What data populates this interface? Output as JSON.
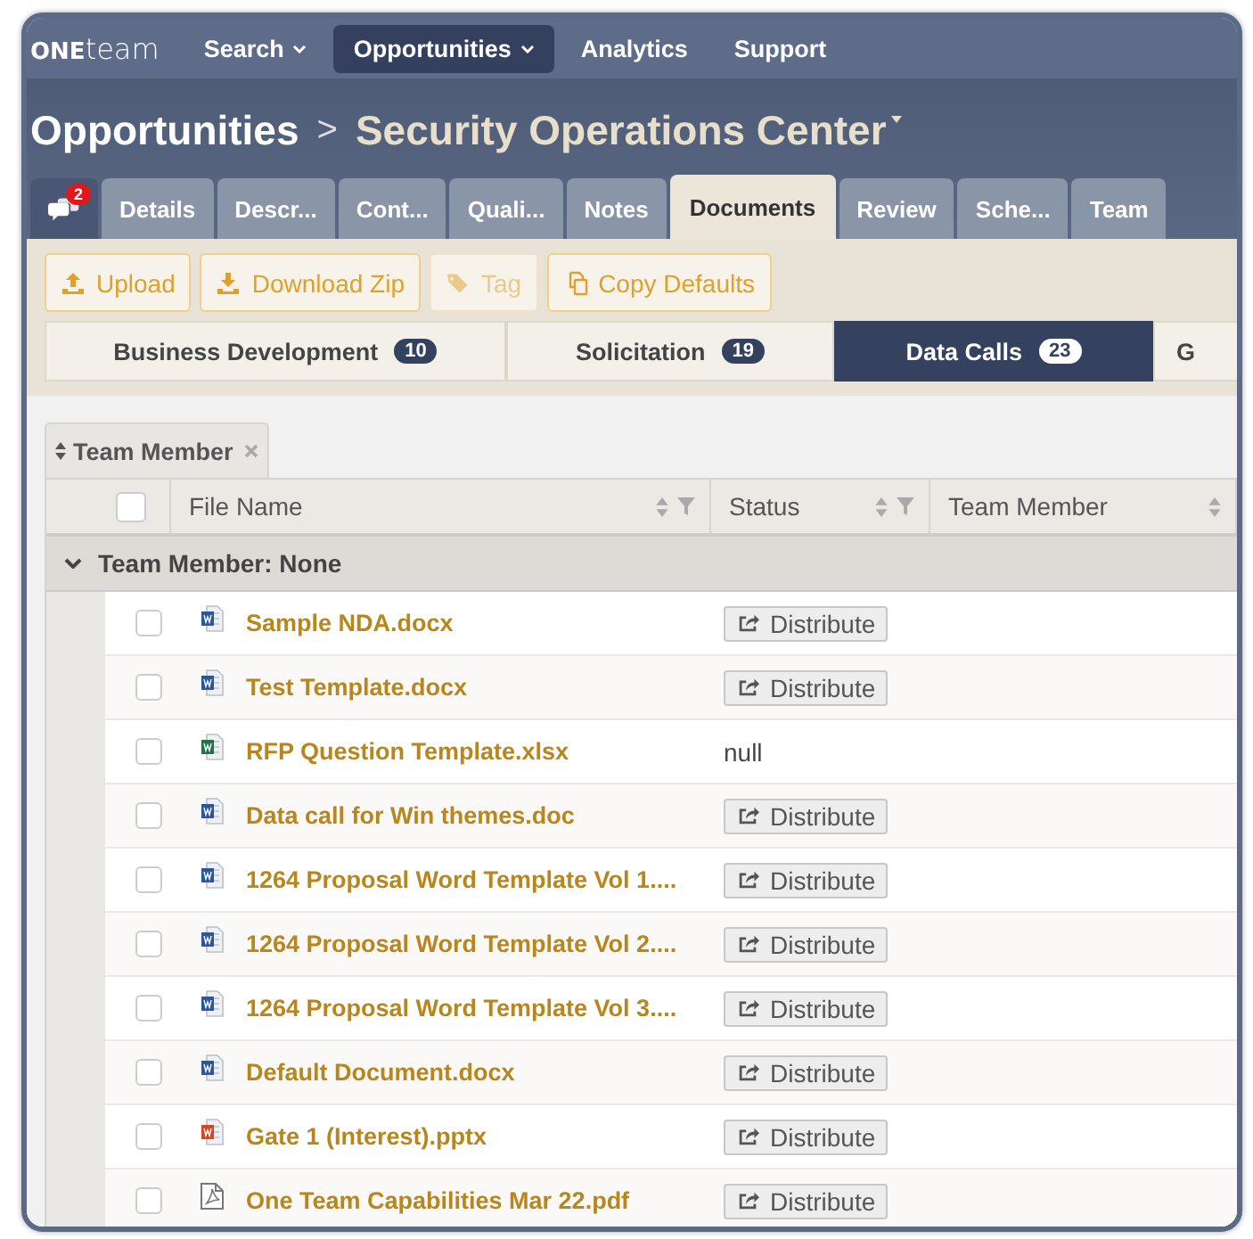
{
  "nav": {
    "brand": "**ONE**team",
    "items": [
      {
        "label": "Search",
        "dropdown": true,
        "selected": false
      },
      {
        "label": "Opportunities",
        "dropdown": true,
        "selected": true
      },
      {
        "label": "Analytics",
        "dropdown": false,
        "selected": false
      },
      {
        "label": "Support",
        "dropdown": false,
        "selected": false
      }
    ]
  },
  "breadcrumb": {
    "parent": "Opportunities",
    "separator": ">",
    "current": "Security Operations Center",
    "dropdown": true
  },
  "messages": {
    "count": "2"
  },
  "tabs": [
    {
      "label": "Details",
      "selected": false
    },
    {
      "label": "Descr...",
      "selected": false
    },
    {
      "label": "Cont...",
      "selected": false
    },
    {
      "label": "Quali...",
      "selected": false
    },
    {
      "label": "Notes",
      "selected": false
    },
    {
      "label": "Documents",
      "selected": true
    },
    {
      "label": "Review",
      "selected": false
    },
    {
      "label": "Sche...",
      "selected": false
    },
    {
      "label": "Team",
      "selected": false
    }
  ],
  "toolbar": [
    {
      "label": "Upload",
      "kind": "upload",
      "disabled": false
    },
    {
      "label": "Download Zip",
      "kind": "download",
      "disabled": false
    },
    {
      "label": "Tag",
      "kind": "tag",
      "disabled": true
    },
    {
      "label": "Copy Defaults",
      "kind": "copy",
      "disabled": false
    }
  ],
  "folders": [
    {
      "label": "Business Development",
      "count": "10",
      "selected": false
    },
    {
      "label": "Solicitation",
      "count": "19",
      "selected": false
    },
    {
      "label": "Data Calls",
      "count": "23",
      "selected": true
    },
    {
      "label": "G",
      "selected": false
    }
  ],
  "group_chip": {
    "label": "Team Member",
    "removable": true
  },
  "columns": [
    {
      "label": "File Name",
      "sortable": true,
      "filter": true
    },
    {
      "label": "Status",
      "sortable": true,
      "filter": true
    },
    {
      "label": "Team Member",
      "sortable": true,
      "filter": false
    }
  ],
  "header_checkbox": {
    "checked": false
  },
  "group": {
    "label": "Team Member: None",
    "expanded": true
  },
  "rows": [
    {
      "file": "Sample NDA.docx",
      "kind": "word",
      "checked": false,
      "status": {
        "kind": "button",
        "text": "Distribute"
      }
    },
    {
      "file": "Test Template.docx",
      "kind": "word",
      "checked": false,
      "status": {
        "kind": "button",
        "text": "Distribute"
      }
    },
    {
      "file": "RFP Question Template.xlsx",
      "kind": "excel",
      "checked": false,
      "status": {
        "kind": "text",
        "text": "null"
      }
    },
    {
      "file": "Data call for Win themes.doc",
      "kind": "word",
      "checked": false,
      "status": {
        "kind": "button",
        "text": "Distribute"
      }
    },
    {
      "file": "1264 Proposal Word Template Vol 1....",
      "kind": "word",
      "checked": false,
      "status": {
        "kind": "button",
        "text": "Distribute"
      }
    },
    {
      "file": "1264 Proposal Word Template Vol 2....",
      "kind": "word",
      "checked": false,
      "status": {
        "kind": "button",
        "text": "Distribute"
      }
    },
    {
      "file": "1264 Proposal Word Template Vol 3....",
      "kind": "word",
      "checked": false,
      "status": {
        "kind": "button",
        "text": "Distribute"
      }
    },
    {
      "file": "Default Document.docx",
      "kind": "word",
      "checked": false,
      "status": {
        "kind": "button",
        "text": "Distribute"
      }
    },
    {
      "file": "Gate 1 (Interest).pptx",
      "kind": "powerpoint",
      "checked": false,
      "status": {
        "kind": "button",
        "text": "Distribute"
      }
    },
    {
      "file": "One Team Capabilities Mar 22.pdf",
      "kind": "pdf",
      "checked": false,
      "status": {
        "kind": "button",
        "text": "Distribute"
      }
    }
  ]
}
